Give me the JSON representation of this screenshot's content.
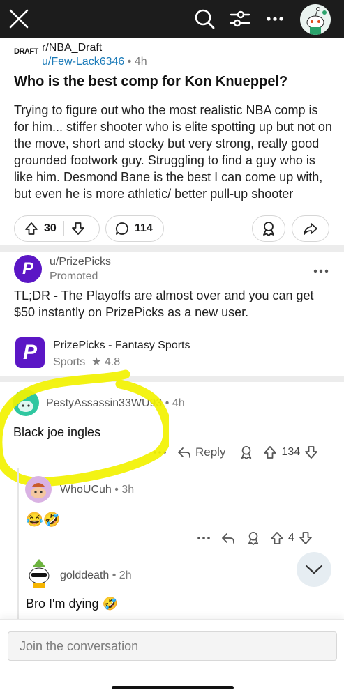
{
  "topbar": {
    "icons": [
      "close-icon",
      "search-icon",
      "sort-filter-icon",
      "more-icon",
      "avatar"
    ]
  },
  "post": {
    "subreddit": "r/NBA_Draft",
    "subreddit_icon_text": "DRAFT",
    "author": "u/Few-Lack6346",
    "time": " • 4h",
    "title": "Who is the best comp for Kon Knueppel?",
    "body": "Trying to figure out who the most realistic NBA comp is for him... stiffer shooter who is elite spotting up but not on the move, short and stocky but very strong, really good grounded footwork guy. Struggling to find a guy who is like him. Desmond Bane is the best I can come up with, but even he is more athletic/ better pull-up shooter",
    "upvotes": "30",
    "comments": "114"
  },
  "promoted": {
    "logo_text": "P",
    "user": "u/PrizePicks",
    "label": "Promoted",
    "text": "TL;DR - The Playoffs are almost over and you can get $50 instantly on PrizePicks as a new user.",
    "app_name": "PrizePicks - Fantasy Sports",
    "app_category": "Sports",
    "app_rating": "★ 4.8",
    "brand_color": "#5b16c5"
  },
  "comments": [
    {
      "user": "PestyAssassin33WU93",
      "time": " • 4h",
      "text": "Black joe ingles",
      "reply_label": "Reply",
      "votes": "134"
    },
    {
      "user": "WhoUCuh",
      "time": " • 3h",
      "text": "😂🤣",
      "votes": "4"
    },
    {
      "user": "golddeath",
      "time": " • 2h",
      "text": "Bro I'm dying 🤣"
    }
  ],
  "composer": {
    "placeholder": "Join the conversation"
  },
  "colors": {
    "topbar": "#1c1c1c",
    "link": "#1a7ab8",
    "highlight": "#f2f200"
  }
}
